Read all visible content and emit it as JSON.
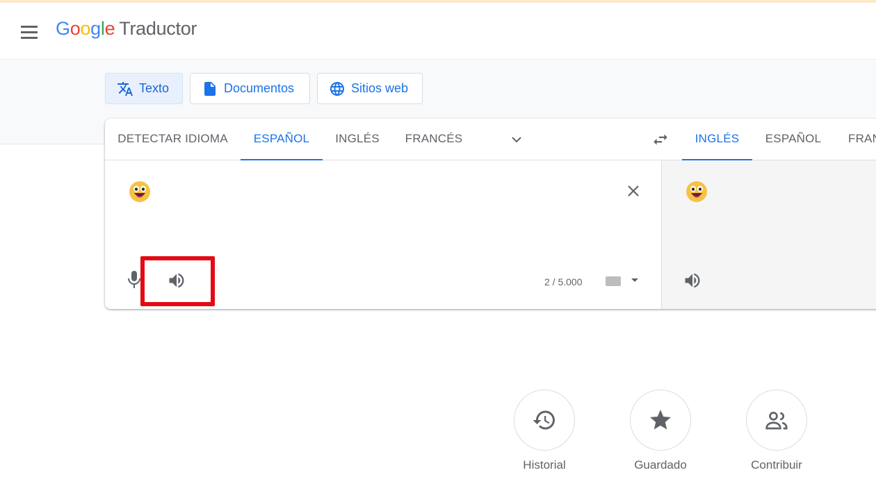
{
  "header": {
    "logo_letters": [
      "G",
      "o",
      "o",
      "g",
      "l",
      "e"
    ],
    "product_name": "Traductor"
  },
  "modes": [
    {
      "label": "Texto",
      "icon": "translate-icon",
      "active": true
    },
    {
      "label": "Documentos",
      "icon": "document-icon",
      "active": false
    },
    {
      "label": "Sitios web",
      "icon": "globe-icon",
      "active": false
    }
  ],
  "source_langs": [
    {
      "label": "DETECTAR IDIOMA",
      "active": false
    },
    {
      "label": "ESPAÑOL",
      "active": true
    },
    {
      "label": "INGLÉS",
      "active": false
    },
    {
      "label": "FRANCÉS",
      "active": false
    }
  ],
  "target_langs": [
    {
      "label": "INGLÉS",
      "active": true
    },
    {
      "label": "ESPAÑOL",
      "active": false
    },
    {
      "label": "FRANCÉS",
      "active": false
    }
  ],
  "source": {
    "text_icon": "grinning-face-emoji",
    "char_count": "2 / 5.000"
  },
  "target": {
    "text_icon": "grinning-face-emoji"
  },
  "bottom_actions": [
    {
      "label": "Historial",
      "icon": "history-icon"
    },
    {
      "label": "Guardado",
      "icon": "star-icon"
    },
    {
      "label": "Contribuir",
      "icon": "people-icon"
    }
  ],
  "colors": {
    "accent": "#1a73e8",
    "highlight": "#e50914"
  }
}
